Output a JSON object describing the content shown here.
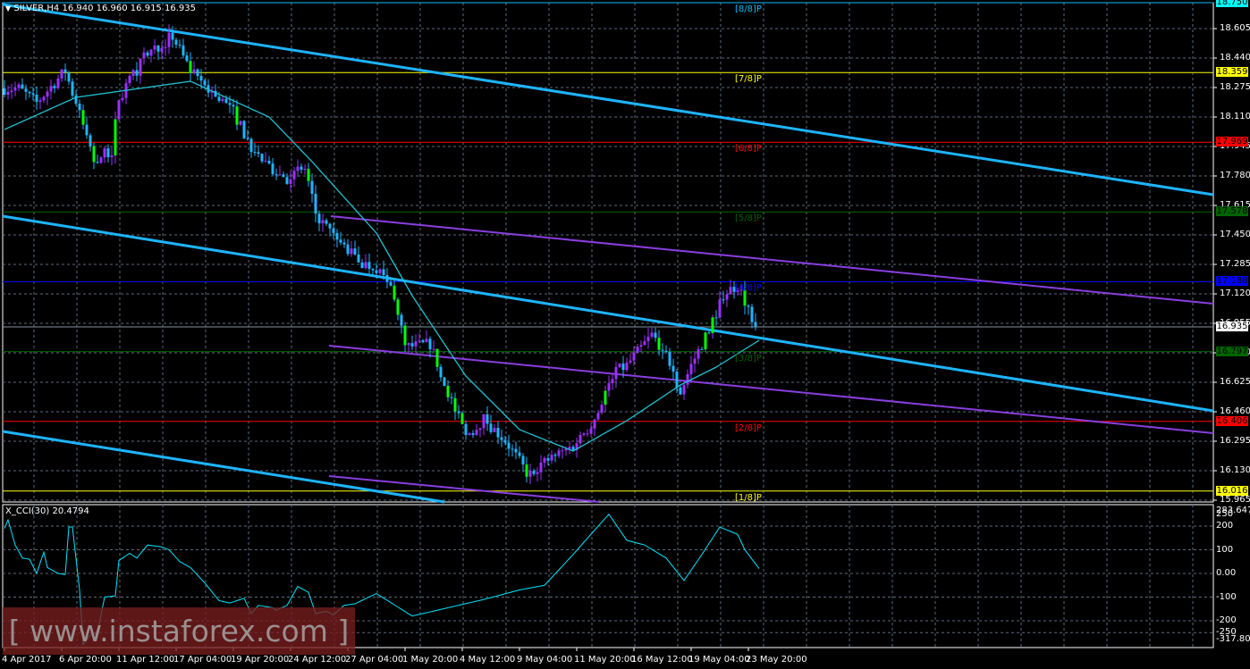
{
  "header": {
    "symbol": "SILVER,H4",
    "ohlc": "16.940 16.960 16.915 16.935",
    "menu_icon": "triangle-down-icon"
  },
  "indicator": {
    "title": "X_CCI(30) 20.4794"
  },
  "price_axis": [
    "18.605",
    "18.440",
    "18.275",
    "18.110",
    "17.945",
    "17.780",
    "17.615",
    "17.450",
    "17.285",
    "17.120",
    "16.955",
    "16.790",
    "16.625",
    "16.460",
    "16.295",
    "16.130",
    "15.965"
  ],
  "price_tags": [
    {
      "value": "18.750",
      "bg": "#00ffff",
      "fg": "#000000"
    },
    {
      "value": "18.359",
      "bg": "#ffff00",
      "fg": "#000000"
    },
    {
      "value": "17.969",
      "bg": "#ff0000",
      "fg": "#000000"
    },
    {
      "value": "17.578",
      "bg": "#006400",
      "fg": "#000000"
    },
    {
      "value": "17.188",
      "bg": "#0000ff",
      "fg": "#000000"
    },
    {
      "value": "16.935",
      "bg": "#ffffff",
      "fg": "#000000"
    },
    {
      "value": "16.797",
      "bg": "#006400",
      "fg": "#000000"
    },
    {
      "value": "16.406",
      "bg": "#ff0000",
      "fg": "#000000"
    },
    {
      "value": "16.016",
      "bg": "#ffff00",
      "fg": "#000000"
    }
  ],
  "murrey_levels": [
    {
      "label": "[8/8]P",
      "price": 18.75,
      "color": "#00bfff"
    },
    {
      "label": "[7/8]P",
      "price": 18.359,
      "color": "#ffff00"
    },
    {
      "label": "[6/8]P",
      "price": 17.969,
      "color": "#ff0000"
    },
    {
      "label": "[5/8]P",
      "price": 17.578,
      "color": "#006400"
    },
    {
      "label": "[4/8]P",
      "price": 17.188,
      "color": "#0000ff"
    },
    {
      "label": "[3/8]P",
      "price": 16.797,
      "color": "#006400"
    },
    {
      "label": "[2/8]P",
      "price": 16.406,
      "color": "#ff0000"
    },
    {
      "label": "[1/8]P",
      "price": 16.016,
      "color": "#ffff00"
    }
  ],
  "cci_axis": [
    "283.6475",
    "250",
    "200",
    "100",
    "0.00",
    "-100",
    "-200",
    "-250",
    "-317.806"
  ],
  "time_axis": [
    "4 Apr 2017",
    "6 Apr 20:00",
    "11 Apr 12:00",
    "17 Apr 04:00",
    "19 Apr 20:00",
    "24 Apr 12:00",
    "27 Apr 04:00",
    "1 May 20:00",
    "4 May 12:00",
    "9 May 04:00",
    "11 May 20:00",
    "16 May 12:00",
    "19 May 04:00",
    "23 May 20:00"
  ],
  "watermark": "[ www.instaforex.com ]",
  "colors": {
    "up": "#9b30ff",
    "down": "#1eb4ff",
    "accent": "#00ff00",
    "ma": "#20c0d0",
    "channel": "#1eb4ff",
    "purple_channel": "#8a3ee0",
    "cci": "#00e5ff",
    "grid": "#5a6a7a"
  },
  "chart_data": {
    "type": "candlestick",
    "symbol": "SILVER",
    "timeframe": "H4",
    "ylim": [
      15.965,
      18.75
    ],
    "current_price": 16.935,
    "close_path": [
      [
        0,
        18.27
      ],
      [
        4,
        18.27
      ],
      [
        9,
        18.19
      ],
      [
        17,
        18.37
      ],
      [
        21,
        18.12
      ],
      [
        25,
        17.87
      ],
      [
        30,
        17.92
      ],
      [
        32,
        18.22
      ],
      [
        40,
        18.47
      ],
      [
        47,
        18.56
      ],
      [
        52,
        18.37
      ],
      [
        57,
        18.27
      ],
      [
        64,
        18.14
      ],
      [
        69,
        17.94
      ],
      [
        74,
        17.82
      ],
      [
        79,
        17.77
      ],
      [
        84,
        17.82
      ],
      [
        87,
        17.57
      ],
      [
        92,
        17.44
      ],
      [
        100,
        17.29
      ],
      [
        104,
        17.27
      ],
      [
        109,
        17.12
      ],
      [
        112,
        16.82
      ],
      [
        119,
        16.84
      ],
      [
        124,
        16.57
      ],
      [
        129,
        16.32
      ],
      [
        134,
        16.42
      ],
      [
        140,
        16.3
      ],
      [
        146,
        16.12
      ],
      [
        152,
        16.19
      ],
      [
        159,
        16.27
      ],
      [
        165,
        16.42
      ],
      [
        170,
        16.67
      ],
      [
        174,
        16.72
      ],
      [
        181,
        16.89
      ],
      [
        185,
        16.79
      ],
      [
        189,
        16.57
      ],
      [
        192,
        16.72
      ],
      [
        197,
        16.92
      ],
      [
        201,
        17.12
      ],
      [
        205,
        17.17
      ],
      [
        210,
        16.94
      ]
    ],
    "ma_path": [
      [
        0,
        18.04
      ],
      [
        20,
        18.22
      ],
      [
        52,
        18.31
      ],
      [
        74,
        18.11
      ],
      [
        86,
        17.86
      ],
      [
        104,
        17.46
      ],
      [
        114,
        17.11
      ],
      [
        129,
        16.66
      ],
      [
        144,
        16.36
      ],
      [
        159,
        16.24
      ],
      [
        174,
        16.41
      ],
      [
        189,
        16.61
      ],
      [
        199,
        16.71
      ],
      [
        211,
        16.86
      ]
    ],
    "cci": {
      "name": "X_CCI(30)",
      "last": 20.4794,
      "ylim": [
        -317.806,
        283.6475
      ],
      "path": [
        [
          0,
          190
        ],
        [
          1,
          226
        ],
        [
          3,
          120
        ],
        [
          5,
          65
        ],
        [
          7,
          60
        ],
        [
          9,
          0
        ],
        [
          11,
          90
        ],
        [
          12,
          25
        ],
        [
          15,
          0
        ],
        [
          17,
          -5
        ],
        [
          18,
          196
        ],
        [
          19,
          196
        ],
        [
          21,
          -70
        ],
        [
          22,
          -300
        ],
        [
          24,
          -260
        ],
        [
          26,
          -250
        ],
        [
          28,
          -100
        ],
        [
          31,
          -95
        ],
        [
          32,
          55
        ],
        [
          35,
          85
        ],
        [
          37,
          65
        ],
        [
          40,
          120
        ],
        [
          44,
          112
        ],
        [
          46,
          100
        ],
        [
          49,
          50
        ],
        [
          52,
          25
        ],
        [
          56,
          -40
        ],
        [
          60,
          -115
        ],
        [
          63,
          -125
        ],
        [
          67,
          -105
        ],
        [
          69,
          -170
        ],
        [
          71,
          -135
        ],
        [
          75,
          -145
        ],
        [
          76,
          -155
        ],
        [
          79,
          -135
        ],
        [
          82,
          -55
        ],
        [
          85,
          -80
        ],
        [
          87,
          -170
        ],
        [
          90,
          -160
        ],
        [
          92,
          -175
        ],
        [
          95,
          -135
        ],
        [
          98,
          -128
        ],
        [
          104,
          -85
        ],
        [
          114,
          -180
        ],
        [
          124,
          -145
        ],
        [
          134,
          -110
        ],
        [
          144,
          -70
        ],
        [
          151,
          -50
        ],
        [
          159,
          80
        ],
        [
          164,
          166
        ],
        [
          169,
          250
        ],
        [
          174,
          140
        ],
        [
          179,
          120
        ],
        [
          185,
          65
        ],
        [
          190,
          -30
        ],
        [
          195,
          80
        ],
        [
          200,
          196
        ],
        [
          205,
          165
        ],
        [
          207,
          100
        ],
        [
          211,
          20.5
        ]
      ]
    }
  }
}
